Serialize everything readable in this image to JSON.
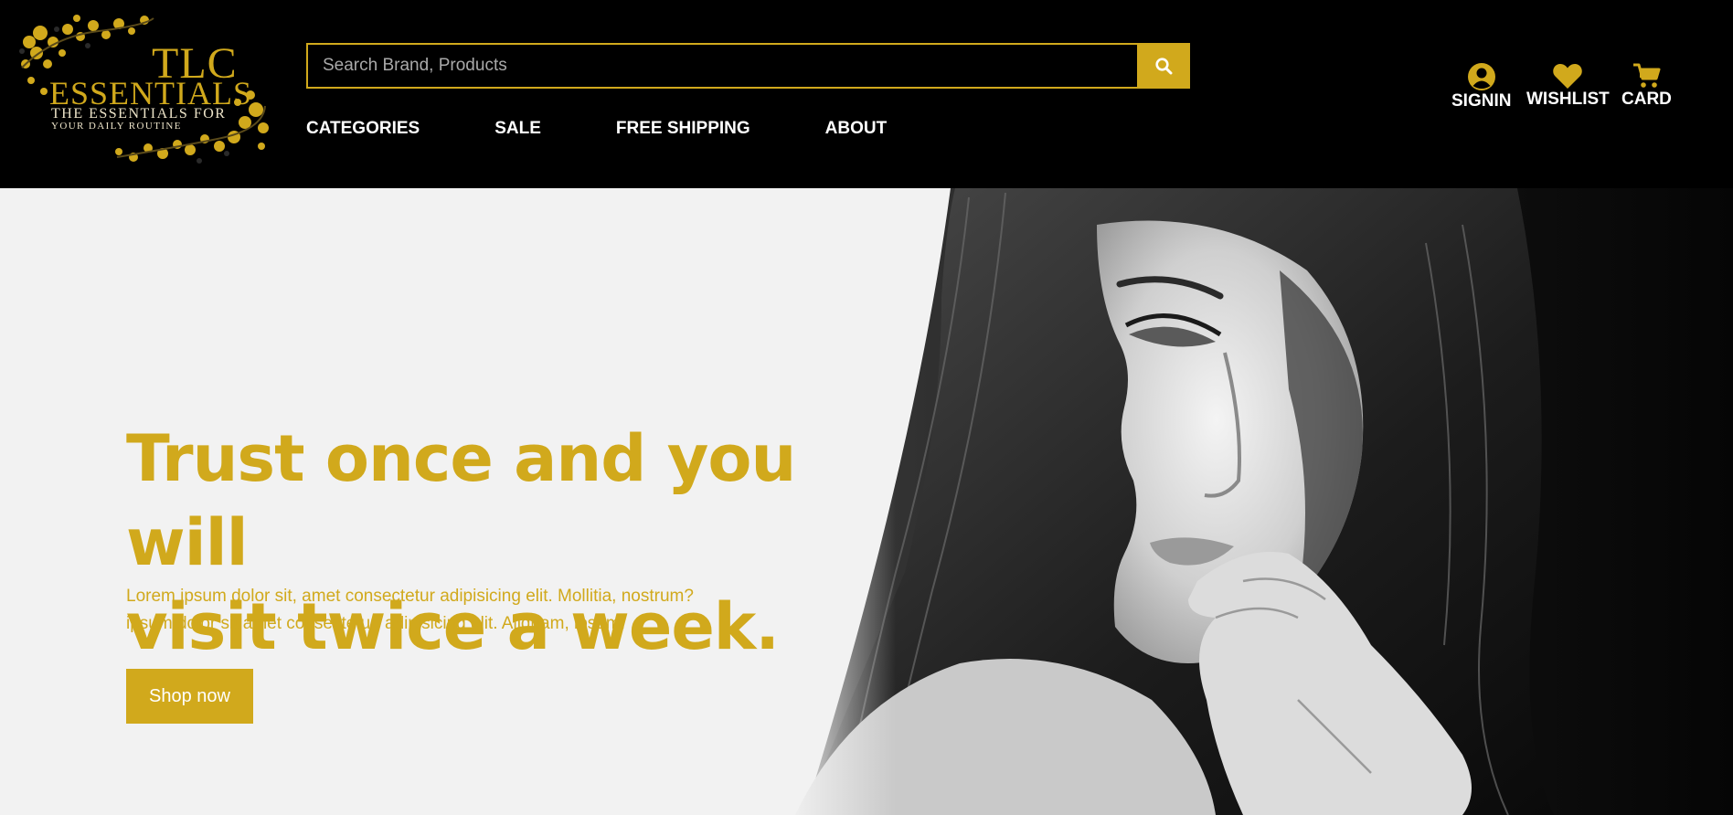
{
  "brand": {
    "logo_tlc": "TLC",
    "logo_essentials": "ESSENTIALS",
    "logo_tagline_1": "THE ESSENTIALS FOR",
    "logo_tagline_2": "YOUR DAILY ROUTINE"
  },
  "search": {
    "placeholder": "Search Brand, Products",
    "icon": "search-icon"
  },
  "nav": {
    "items": [
      "CATEGORIES",
      "SALE",
      "FREE SHIPPING",
      "ABOUT"
    ]
  },
  "actions": {
    "signin": {
      "label": "SIGNIN",
      "icon": "user-icon"
    },
    "wishlist": {
      "label": "WISHLIST",
      "icon": "heart-icon"
    },
    "cart": {
      "label": "CARD",
      "icon": "cart-icon"
    }
  },
  "hero": {
    "title_line_1": "Trust once and you will",
    "title_line_2": "visit twice a week.",
    "text_line_1": "Lorem ipsum dolor sit, amet consectetur adipisicing elit. Mollitia, nostrum?",
    "text_line_2": "ipsum dolor sit amet consectetur, adipisicing elit. Aliquam, ipsum!",
    "button_label": "Shop now"
  },
  "colors": {
    "accent": "#d1a91c",
    "header_bg": "#000000",
    "hero_bg": "#f2f2f2",
    "nav_text": "#ffffff"
  }
}
